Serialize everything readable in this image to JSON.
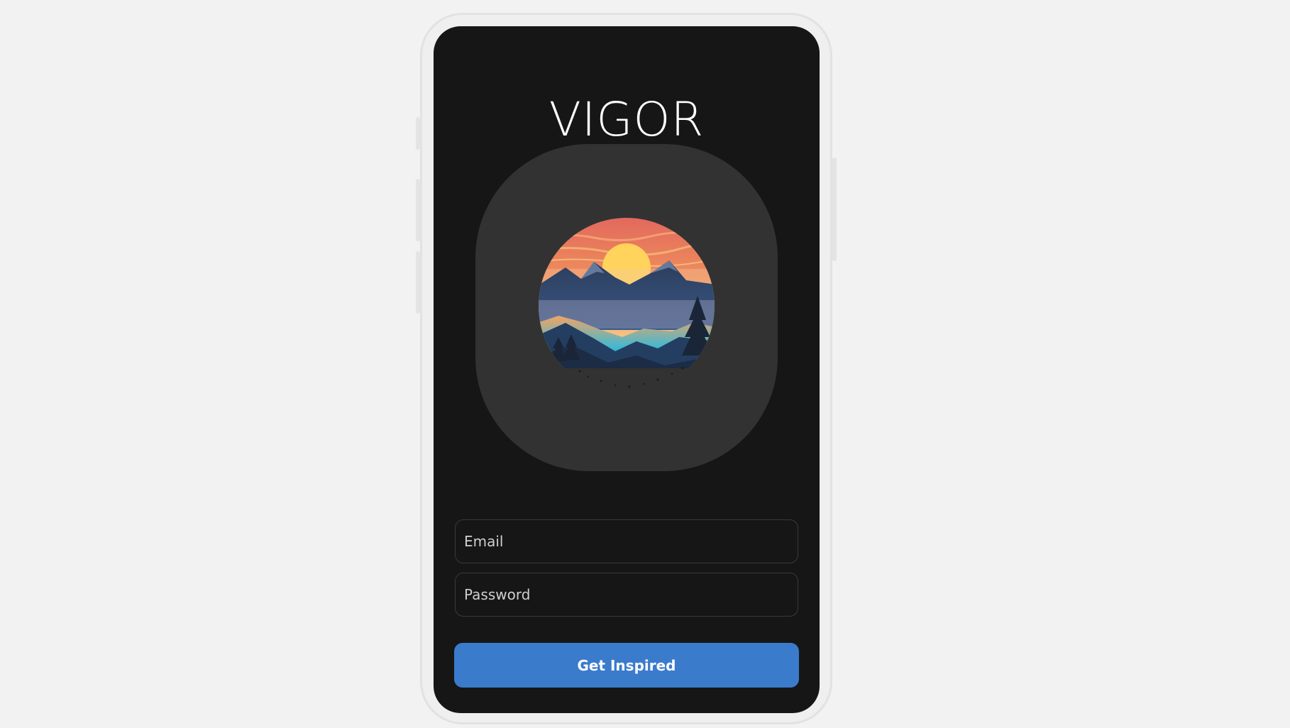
{
  "app": {
    "brand_title": "VIGOR"
  },
  "logo": {
    "icon": "mountain-sunset-logo",
    "colors": {
      "sky_top": "#e2685d",
      "sky_mid": "#f0a35a",
      "sun": "#ffd35c",
      "mountain_dark": "#1f2f4a",
      "valley_glow": "#3fb9d3"
    }
  },
  "form": {
    "email_placeholder": "Email",
    "password_placeholder": "Password",
    "submit_label": "Get Inspired"
  },
  "theme": {
    "background": "#161616",
    "card": "#323232",
    "accent": "#3a7bcc"
  }
}
